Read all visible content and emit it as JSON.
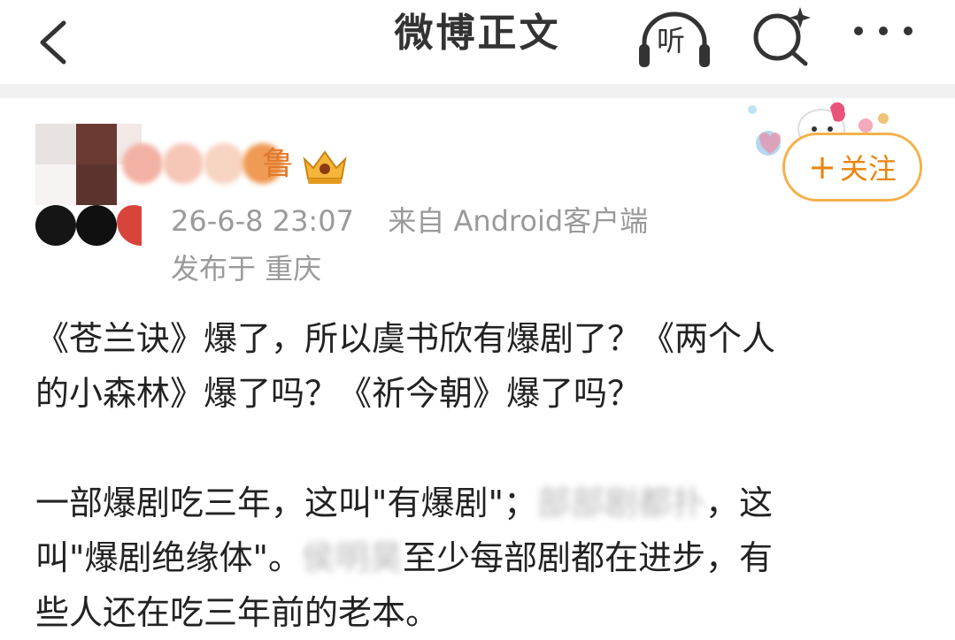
{
  "header": {
    "title": "微博正文",
    "listen_label": "听",
    "icons": [
      "back-arrow-icon",
      "headphones-icon",
      "search-sparkle-icon",
      "more-dots-icon"
    ]
  },
  "post": {
    "author_suffix": "鲁",
    "timestamp": "26-6-8 23:07",
    "source": "来自 Android客户端",
    "location": "发布于 重庆",
    "follow_label": "关注",
    "para1_line1": "《苍兰诀》爆了，所以虞书欣有爆剧了？《两个人",
    "para1_line2": "的小森林》爆了吗？《祈今朝》爆了吗？",
    "para2_line1_a": "一部爆剧吃三年，这叫\"有爆剧\"；",
    "para2_line1_blur": "部部剧都扑",
    "para2_line1_b": "，这",
    "para2_line2_a": "叫\"爆剧绝缘体\"。",
    "para2_line2_blur": "侯明昊",
    "para2_line2_b": "至少每部剧都在进步，有",
    "para2_line3": "些人还在吃三年前的老本。"
  },
  "colors": {
    "accent_orange": "#e8850c",
    "follow_border": "#f4b04a",
    "meta_gray": "#9a9a9a"
  }
}
